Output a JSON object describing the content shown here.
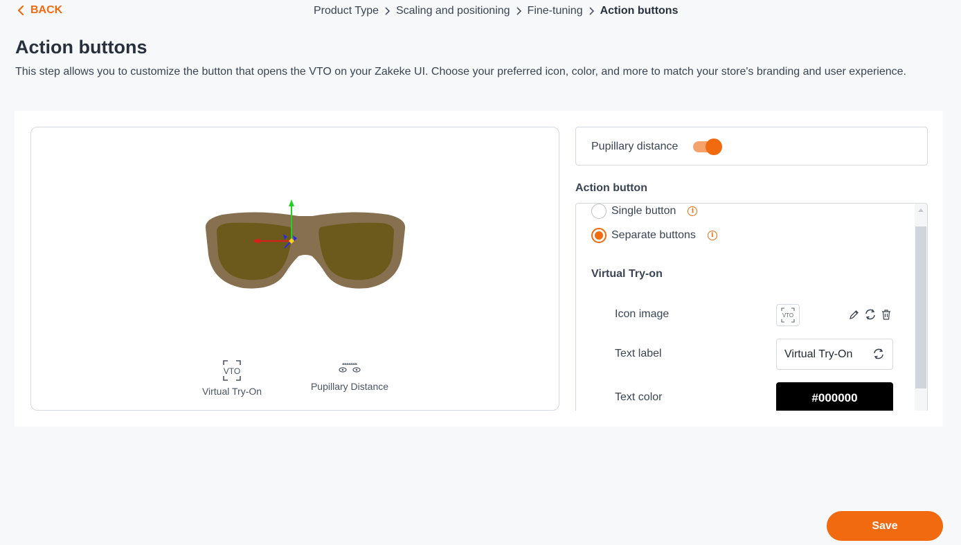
{
  "nav": {
    "back_label": "BACK",
    "breadcrumb": [
      "Product Type",
      "Scaling and positioning",
      "Fine-tuning",
      "Action buttons"
    ]
  },
  "page": {
    "title": "Action buttons",
    "description": "This step allows you to customize the button that opens the VTO on your Zakeke UI. Choose your preferred icon, color, and more to match your store's branding and user experience."
  },
  "preview": {
    "buttons": [
      {
        "label": "Virtual Try-On",
        "icon": "vto-icon",
        "icon_text": "VTO"
      },
      {
        "label": "Pupillary Distance",
        "icon": "pupillary-distance-icon"
      }
    ]
  },
  "settings": {
    "pupillary_distance": {
      "label": "Pupillary distance",
      "enabled": true
    },
    "action_button": {
      "section_label": "Action button",
      "options": [
        {
          "label": "Single button",
          "checked": false
        },
        {
          "label": "Separate buttons",
          "checked": true
        }
      ],
      "virtual_try_on": {
        "title": "Virtual Try-on",
        "icon_image_label": "Icon image",
        "icon_image_text": "VTO",
        "text_label_label": "Text label",
        "text_label_value": "Virtual Try-On",
        "text_color_label": "Text color",
        "text_color_value": "#000000"
      }
    }
  },
  "footer": {
    "save_label": "Save"
  },
  "colors": {
    "accent": "#f26a10",
    "text": "#3a4452",
    "border": "#d5d9de"
  }
}
